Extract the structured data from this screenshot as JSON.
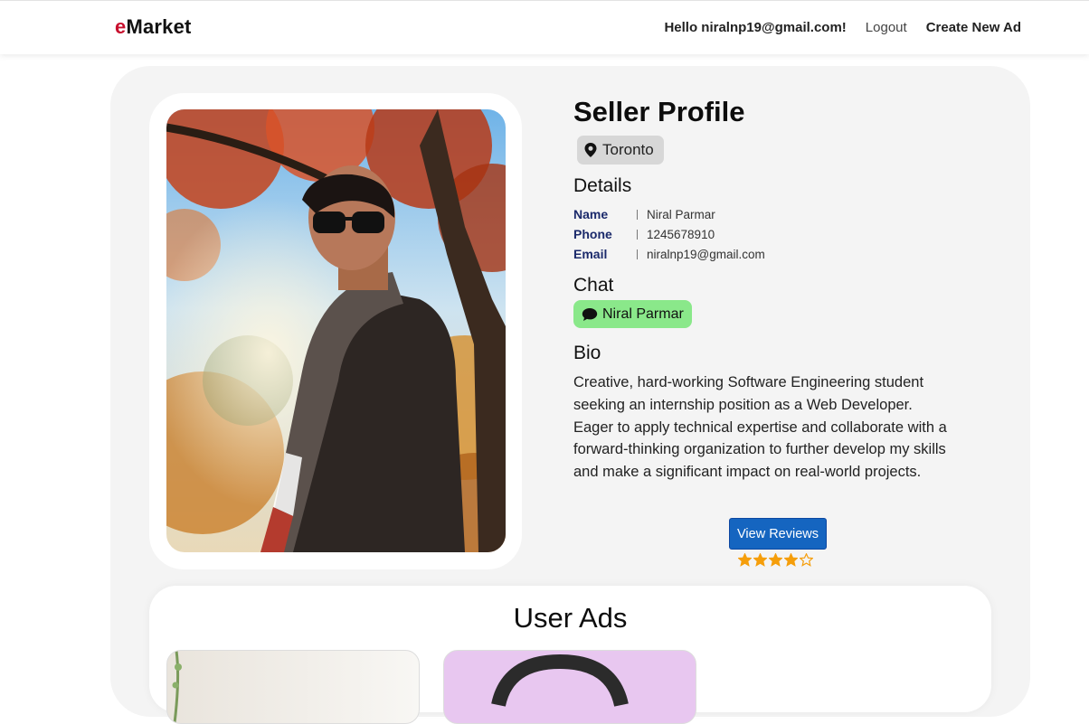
{
  "nav": {
    "brand_first": "e",
    "brand_rest": "Market",
    "greeting": "Hello niralnp19@gmail.com!",
    "logout": "Logout",
    "create": "Create New Ad"
  },
  "profile": {
    "title": "Seller Profile",
    "location": "Toronto",
    "details_heading": "Details",
    "details": [
      {
        "key": "Name",
        "value": "Niral Parmar"
      },
      {
        "key": "Phone",
        "value": "1245678910"
      },
      {
        "key": "Email",
        "value": "niralnp19@gmail.com"
      }
    ],
    "chat_heading": "Chat",
    "chat_label": "Niral Parmar",
    "bio_heading": "Bio",
    "bio": "Creative, hard-working Software Engineering student seeking an internship position as a Web Developer. Eager to apply technical expertise and collaborate with a forward-thinking organization to further develop my skills and make a significant impact on real-world projects.",
    "reviews_button": "View Reviews",
    "rating": 4,
    "rating_max": 5
  },
  "ads": {
    "heading": "User Ads"
  },
  "colors": {
    "brand_accent": "#c8102e",
    "chat_green": "#8ae88a",
    "reviews_blue": "#1565c0",
    "star_orange": "#f59e0b",
    "label_navy": "#1b2a6b"
  }
}
